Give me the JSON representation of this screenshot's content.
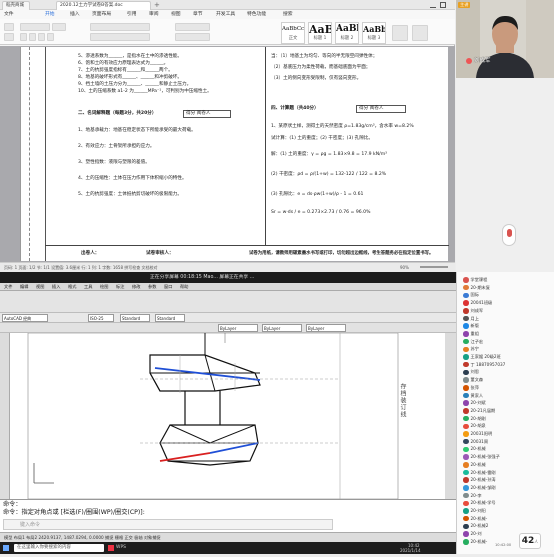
{
  "word": {
    "tabs": [
      "稻壳商城",
      "2020.12土力学试卷B答案.doc"
    ],
    "menus": [
      "文件",
      "开始",
      "插入",
      "页面布局",
      "引用",
      "审阅",
      "视图",
      "章节",
      "开发工具",
      "特色功能",
      "搜索"
    ],
    "active_menu": "开始",
    "styles": [
      {
        "big": "AaBbCcDd",
        "name": "正文"
      },
      {
        "big": "AaB",
        "name": "标题 1"
      },
      {
        "big": "AaBb(",
        "name": "标题 2"
      },
      {
        "big": "AaBb(",
        "name": "标题 3"
      }
    ],
    "status": "页码: 1  页面: 1/2  节: 1/1  设置值: 3.6厘米  行: 1  列: 1  字数: 1658  拼写检查  文档校对",
    "zoom": "90%",
    "left_col": [
      "5、渗透系数为______，是指水在土中的渗透性能。",
      "6、饱和土的有效应力原理表达式为______。",
      "7、土的抗剪强度指标有______和______两个。",
      "8、地基的破坏形式有______、______和冲剪破坏。",
      "9、挡土墙的土压力分为______、______和静止土压力。",
      "10、土的压缩系数 a1-2 为______MPa⁻¹，可判别为中压缩性土。",
      "二、名词解释题（每题3分，共20分）",
      "1、地基承载力：地基在稳定状态下所能承受的最大荷载。",
      "2、有效应力：土骨架所承担的应力。",
      "3、塑性指数：液限与塑限的差值。",
      "4、土的压缩性：土体在压力作用下体积缩小的特性。",
      "5、土的抗剪强度：土体抵抗剪切破坏的极限能力。"
    ],
    "right_col": [
      "当：（1）地基土为均匀、等向的半无限空间弹性体；",
      "（2）基底压力为柔性荷载，而基础底面为平面；",
      "（3）土的侧向变形受限制，仅有竖向变形。",
      "四、计算题（共40分）",
      "1、某原状土样，测得土的天然密度 ρ=1.83g/cm³，含水率 w=8.2%",
      "试计算：(1) 土的重度；(2) 干密度；(3) 孔隙比。",
      "解：(1) 土的重度：γ = ρg = 1.83×9.8 = 17.9 kN/m³",
      "(2) 干密度：ρd = ρ/(1+w) = 132-122 / 122 = 8.2%",
      "(3) 孔隙比：e = ds·ρw(1+w)/ρ - 1 = 0.61",
      "    Sr = w·ds / e = 0.273×2.73 / 0.76 = 96.0%"
    ],
    "box_label": "得分  阅卷人",
    "footer_left": "出卷人：",
    "footer_mid": "试卷审核人：",
    "footer_right": "试卷为用纸，请教师用碳素墨水书写或打印，切勿超出边框线，考生答题务必在指定位置书写。"
  },
  "video": {
    "name": "刘成军",
    "badge": "主讲"
  },
  "cad": {
    "title": "正在分享屏幕    00:18:15    Mao... 屏幕正在共享 ...",
    "menus": [
      "文件",
      "编辑",
      "视图",
      "插入",
      "格式",
      "工具",
      "绘图",
      "标注",
      "修改",
      "参数",
      "窗口",
      "帮助"
    ],
    "layer_dd": "AutoCAD 经典",
    "dd1": "ISO-25",
    "dd2": "Standard",
    "dd3": "Standard",
    "dd4": "ByLayer",
    "stamp": "存档装订线",
    "cmd1": "命令：",
    "cmd2": "命令：指定对角点或 [栏选(F)/圈围(WP)/圈交(CP)]:",
    "cmd_prompt": "键入命令",
    "status": "模型  布局1  布局2       2420.9137, 1487.0294, 0.0000    捕捉  栅格  正交  极轴  对象捕捉",
    "taskbar_search": "在这里输入你要搜索的内容",
    "clock_time": "10:42",
    "clock_date": "2021/1/14",
    "wps_label": "WPS"
  },
  "participants": [
    {
      "name": "学堂课程",
      "color": "#d9534f"
    },
    {
      "name": "20-期末复",
      "color": "#e07b39"
    },
    {
      "name": "国际",
      "color": "#3a7bd5"
    },
    {
      "name": "20041班级",
      "color": "#d33"
    },
    {
      "name": "刘成军",
      "color": "#c0392b"
    },
    {
      "name": "月上",
      "color": "#555"
    },
    {
      "name": "新版",
      "color": "#1e88e5"
    },
    {
      "name": "重组",
      "color": "#8e44ad"
    },
    {
      "name": "江子宏",
      "color": "#27ae60"
    },
    {
      "name": "苏宁",
      "color": "#e67e22"
    },
    {
      "name": "王家嫂 20级2班",
      "color": "#16a085"
    },
    {
      "name": "丁 18870957037",
      "color": "#c0392b"
    },
    {
      "name": "刘思",
      "color": "#2c3e50"
    },
    {
      "name": "董文森",
      "color": "#7f8c8d"
    },
    {
      "name": "张萍",
      "color": "#d35400"
    },
    {
      "name": "黄家人",
      "color": "#2980b9"
    },
    {
      "name": "20-刘斌",
      "color": "#8e44ad"
    },
    {
      "name": "20-21凡届期",
      "color": "#c0392b"
    },
    {
      "name": "20-胡刚",
      "color": "#27ae60"
    },
    {
      "name": "20-胡泉",
      "color": "#e74c3c"
    },
    {
      "name": "20031阳明",
      "color": "#f39c12"
    },
    {
      "name": "20031周",
      "color": "#34495e"
    },
    {
      "name": "20-机械",
      "color": "#2ecc71"
    },
    {
      "name": "20-机械-张强子",
      "color": "#9b59b6"
    },
    {
      "name": "20-机械",
      "color": "#e67e22"
    },
    {
      "name": "20-机械-雷刚",
      "color": "#1abc9c"
    },
    {
      "name": "20-机械-孙涛",
      "color": "#c0392b"
    },
    {
      "name": "20-机械-邹刚",
      "color": "#3498db"
    },
    {
      "name": "20-李",
      "color": "#7f8c8d"
    },
    {
      "name": "20-机械-学号",
      "color": "#e74c3c"
    },
    {
      "name": "20-刘阳",
      "color": "#16a085"
    },
    {
      "name": "20-机械-",
      "color": "#d35400"
    },
    {
      "name": "20-机械2",
      "color": "#2c3e50"
    },
    {
      "name": "20-刘",
      "color": "#8e44ad"
    },
    {
      "name": "20-机械-",
      "color": "#27ae60"
    }
  ],
  "chat_badge": "42",
  "chat_badge_unit": "人",
  "chat_time": "10:42:00"
}
